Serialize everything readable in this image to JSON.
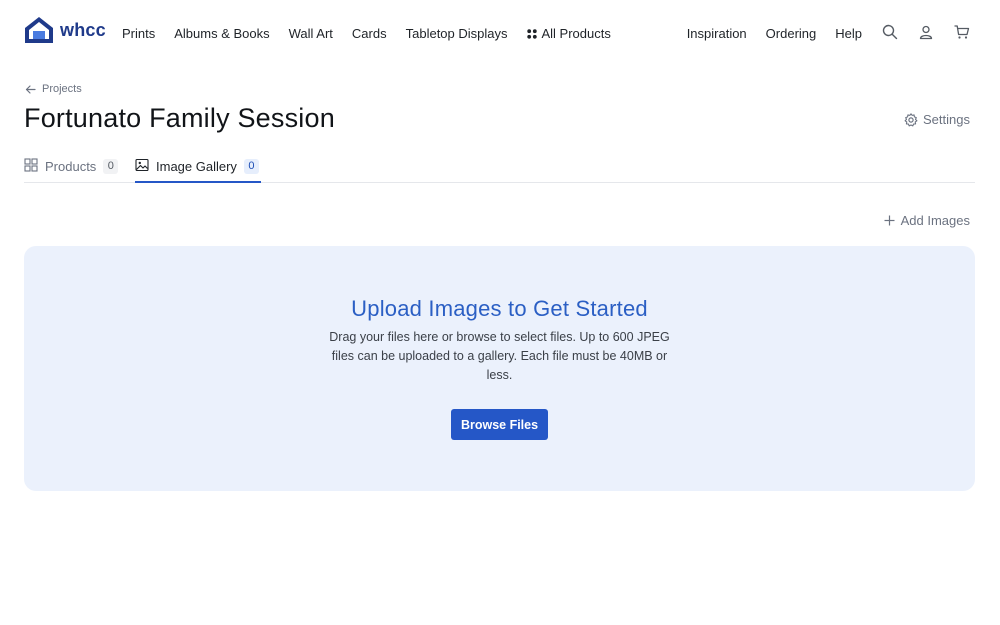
{
  "brand": {
    "name": "whcc",
    "color": "#1f3a8a"
  },
  "nav": {
    "left": [
      "Prints",
      "Albums & Books",
      "Wall Art",
      "Cards",
      "Tabletop Displays"
    ],
    "all_products": "All Products",
    "right": [
      "Inspiration",
      "Ordering",
      "Help"
    ],
    "icons": [
      "search-icon",
      "user-icon",
      "cart-icon"
    ]
  },
  "breadcrumb": {
    "label": "Projects",
    "icon": "arrow-left-icon"
  },
  "page": {
    "title": "Fortunato Family Session",
    "settings_label": "Settings"
  },
  "tabs": [
    {
      "label": "Products",
      "count": "0",
      "icon": "grid-icon",
      "active": false
    },
    {
      "label": "Image Gallery",
      "count": "0",
      "icon": "image-icon",
      "active": true
    }
  ],
  "actions": {
    "add_images": "Add Images"
  },
  "dropzone": {
    "title": "Upload Images to Get Started",
    "description": "Drag your files here or browse to select files. Up to 600 JPEG files can be uploaded to a gallery. Each file must be 40MB or less.",
    "button": "Browse Files"
  },
  "colors": {
    "accent": "#2557c7",
    "dropzone_bg": "#ebf1fc",
    "title_blue": "#2b5fc4"
  }
}
